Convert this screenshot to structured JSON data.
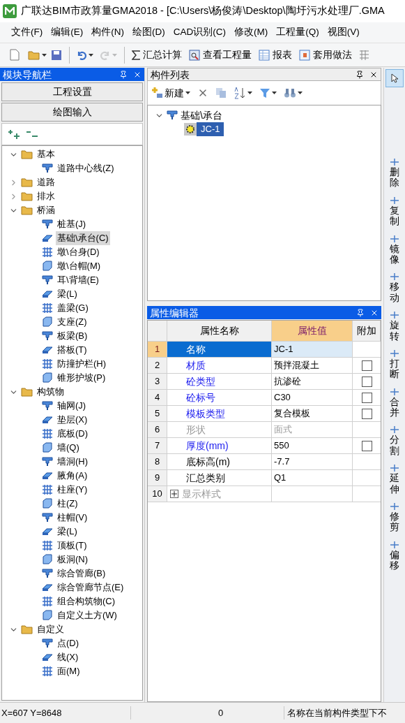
{
  "window": {
    "title": "广联达BIM市政算量GMA2018 - [C:\\Users\\杨俊涛\\Desktop\\陶圩污水处理厂.GMA"
  },
  "menu": [
    "文件(F)",
    "编辑(E)",
    "构件(N)",
    "绘图(D)",
    "CAD识别(C)",
    "修改(M)",
    "工程量(Q)",
    "视图(V)"
  ],
  "history": {
    "undo_disabled": false,
    "redo_disabled": true
  },
  "toolbar": [
    {
      "label": "汇总计算"
    },
    {
      "label": "查看工程量"
    },
    {
      "label": "报表"
    },
    {
      "label": "套用做法"
    }
  ],
  "nav": {
    "title": "模块导航栏",
    "active": true,
    "buttons": [
      "工程设置",
      "绘图输入"
    ],
    "tree": [
      {
        "label": "基本",
        "kind": "folder",
        "expanded": true,
        "selected": false,
        "children": [
          {
            "label": "道路中心线(Z)",
            "kind": "item",
            "selected": false
          }
        ]
      },
      {
        "label": "道路",
        "kind": "folder",
        "expanded": false,
        "selected": false
      },
      {
        "label": "排水",
        "kind": "folder",
        "expanded": false,
        "selected": false
      },
      {
        "label": "桥涵",
        "kind": "folder",
        "expanded": true,
        "selected": false,
        "children": [
          {
            "label": "桩基(J)",
            "kind": "item",
            "selected": false
          },
          {
            "label": "基础\\承台(C)",
            "kind": "item",
            "selected": true
          },
          {
            "label": "墩\\台身(D)",
            "kind": "item",
            "selected": false
          },
          {
            "label": "墩\\台帽(M)",
            "kind": "item",
            "selected": false
          },
          {
            "label": "耳\\背墙(E)",
            "kind": "item",
            "selected": false
          },
          {
            "label": "梁(L)",
            "kind": "item",
            "selected": false
          },
          {
            "label": "盖梁(G)",
            "kind": "item",
            "selected": false
          },
          {
            "label": "支座(Z)",
            "kind": "item",
            "selected": false
          },
          {
            "label": "板梁(B)",
            "kind": "item",
            "selected": false
          },
          {
            "label": "搭板(T)",
            "kind": "item",
            "selected": false
          },
          {
            "label": "防撞护栏(H)",
            "kind": "item",
            "selected": false
          },
          {
            "label": "锥形护坡(P)",
            "kind": "item",
            "selected": false
          }
        ]
      },
      {
        "label": "构筑物",
        "kind": "folder",
        "expanded": true,
        "selected": false,
        "children": [
          {
            "label": "轴网(J)",
            "kind": "item",
            "selected": false
          },
          {
            "label": "垫层(X)",
            "kind": "item",
            "selected": false
          },
          {
            "label": "底板(D)",
            "kind": "item",
            "selected": false
          },
          {
            "label": "墙(Q)",
            "kind": "item",
            "selected": false
          },
          {
            "label": "墙洞(H)",
            "kind": "item",
            "selected": false
          },
          {
            "label": "腋角(A)",
            "kind": "item",
            "selected": false
          },
          {
            "label": "柱座(Y)",
            "kind": "item",
            "selected": false
          },
          {
            "label": "柱(Z)",
            "kind": "item",
            "selected": false
          },
          {
            "label": "柱帽(V)",
            "kind": "item",
            "selected": false
          },
          {
            "label": "梁(L)",
            "kind": "item",
            "selected": false
          },
          {
            "label": "顶板(T)",
            "kind": "item",
            "selected": false
          },
          {
            "label": "板洞(N)",
            "kind": "item",
            "selected": false
          },
          {
            "label": "综合管廊(B)",
            "kind": "item",
            "selected": false
          },
          {
            "label": "综合管廊节点(E)",
            "kind": "item",
            "selected": false
          },
          {
            "label": "组合构筑物(C)",
            "kind": "item",
            "selected": false
          },
          {
            "label": "自定义土方(W)",
            "kind": "item",
            "selected": false
          }
        ]
      },
      {
        "label": "自定义",
        "kind": "folder",
        "expanded": true,
        "selected": false,
        "children": [
          {
            "label": "点(D)",
            "kind": "item",
            "selected": false
          },
          {
            "label": "线(X)",
            "kind": "item",
            "selected": false
          },
          {
            "label": "面(M)",
            "kind": "item",
            "selected": false
          }
        ]
      }
    ]
  },
  "component_list": {
    "title": "构件列表",
    "active": false,
    "new_label": "新建",
    "tree": [
      {
        "label": "基础\\承台",
        "expanded": true,
        "children": [
          {
            "label": "JC-1",
            "selected": true
          }
        ]
      }
    ]
  },
  "properties": {
    "title": "属性编辑器",
    "active": true,
    "columns": [
      "属性名称",
      "属性值",
      "附加"
    ],
    "rows": [
      {
        "index": "1",
        "name": "名称",
        "value": "JC-1",
        "selected": true,
        "public": false,
        "disabled": false
      },
      {
        "index": "2",
        "name": "材质",
        "value": "预拌混凝土",
        "selected": false,
        "public": true,
        "disabled": false,
        "attach": {
          "checked": false
        }
      },
      {
        "index": "3",
        "name": "砼类型",
        "value": "抗渗砼",
        "selected": false,
        "public": true,
        "disabled": false,
        "attach": {
          "checked": false
        }
      },
      {
        "index": "4",
        "name": "砼标号",
        "value": "C30",
        "selected": false,
        "public": true,
        "disabled": false,
        "attach": {
          "checked": false
        }
      },
      {
        "index": "5",
        "name": "模板类型",
        "value": "复合模板",
        "selected": false,
        "public": true,
        "disabled": false,
        "attach": {
          "checked": false
        }
      },
      {
        "index": "6",
        "name": "形状",
        "value": "面式",
        "selected": false,
        "public": false,
        "disabled": true
      },
      {
        "index": "7",
        "name": "厚度(mm)",
        "value": "550",
        "selected": false,
        "public": true,
        "disabled": false,
        "attach": {
          "checked": false
        }
      },
      {
        "index": "8",
        "name": "底标高(m)",
        "value": "-7.7",
        "selected": false,
        "public": false,
        "disabled": false
      },
      {
        "index": "9",
        "name": "汇总类别",
        "value": "Q1",
        "selected": false,
        "public": false,
        "disabled": false
      },
      {
        "index": "10",
        "name": "显示样式",
        "selected": false,
        "public": false,
        "disabled": true,
        "expandable": true,
        "expanded": false
      }
    ]
  },
  "tools": {
    "pointer": {
      "selected": true
    },
    "items": [
      {
        "label": "删除"
      },
      {
        "label": "复制"
      },
      {
        "label": "镜像"
      },
      {
        "label": "移动"
      },
      {
        "label": "旋转"
      },
      {
        "label": "打断"
      },
      {
        "label": "合并"
      },
      {
        "label": "分割"
      },
      {
        "label": "延伸"
      },
      {
        "label": "修剪"
      },
      {
        "label": "偏移"
      }
    ]
  },
  "status_bar": [
    "X=607 Y=8648",
    "0",
    "名称在当前构件类型下不"
  ]
}
